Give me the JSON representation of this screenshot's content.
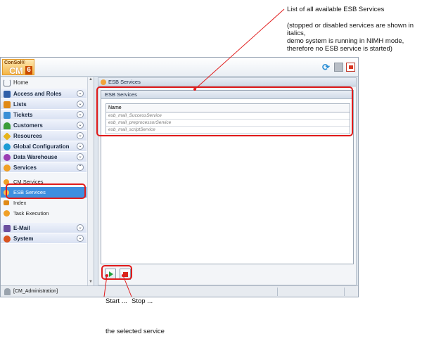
{
  "annotations": {
    "list_label": "List of all available ESB Services",
    "note_line1": "(stopped or disabled services are shown in",
    "note_line2": "italics,",
    "note_line3": "demo system is running in NIMH mode,",
    "note_line4": "therefore no ESB service is started)",
    "start": "Start ...",
    "stop": "Stop ...",
    "selected": "the selected service"
  },
  "logo": {
    "line1": "ConSol®",
    "line2": "CM",
    "version": "6"
  },
  "sidebar": {
    "home": "Home",
    "groups": [
      {
        "label": "Access and Roles",
        "icon": "shield-icon",
        "color": "#2f5fa8"
      },
      {
        "label": "Lists",
        "icon": "list-icon",
        "color": "#e08a16"
      },
      {
        "label": "Tickets",
        "icon": "ticket-icon",
        "color": "#3a8fd6"
      },
      {
        "label": "Customers",
        "icon": "customer-icon",
        "color": "#3a9d3a"
      },
      {
        "label": "Resources",
        "icon": "resource-icon",
        "color": "#e6b41c"
      },
      {
        "label": "Global Configuration",
        "icon": "globe-icon",
        "color": "#1b9bd4"
      },
      {
        "label": "Data Warehouse",
        "icon": "warehouse-icon",
        "color": "#9b3db3"
      },
      {
        "label": "Services",
        "icon": "services-icon",
        "color": "#f0a026"
      }
    ],
    "services_items": [
      "CM Services",
      "ESB Services",
      "Index",
      "Task Execution"
    ],
    "groups_bottom": [
      {
        "label": "E-Mail",
        "icon": "mail-icon",
        "color": "#6b4f9e"
      },
      {
        "label": "System",
        "icon": "system-icon",
        "color": "#d9531e"
      }
    ]
  },
  "main": {
    "header": "ESB Services",
    "panel_title": "ESB Services",
    "column": "Name",
    "rows": [
      "esb_mail_SuccessService",
      "esb_mail_preprocessorService",
      "esb_mail_scriptService"
    ]
  },
  "statusbar": {
    "user": "[CM_Administration]"
  },
  "colors": {
    "highlight": "#e11b1b",
    "selected": "#3d8fe0"
  }
}
